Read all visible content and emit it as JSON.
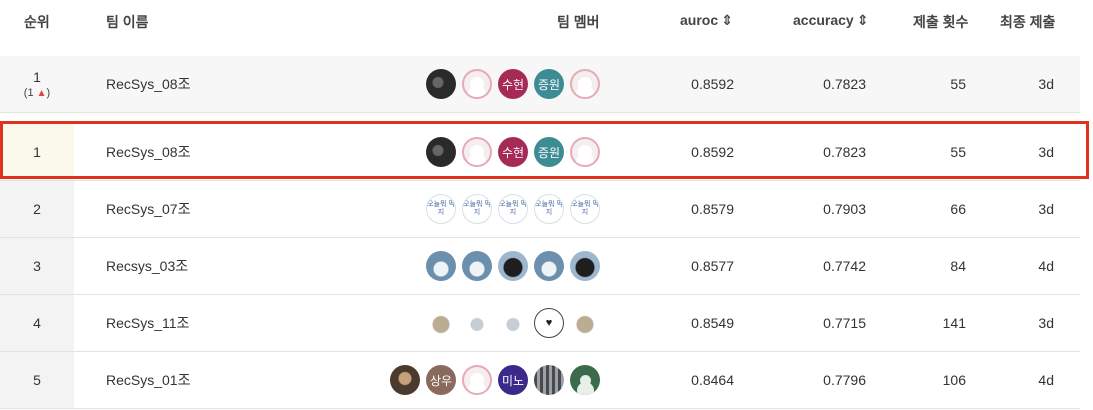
{
  "header": {
    "rank": "순위",
    "team": "팀 이름",
    "members": "팀 멤버",
    "auroc": "auroc",
    "accuracy": "accuracy",
    "submissions": "제출 횟수",
    "last": "최종 제출",
    "sort_icon": "⇕"
  },
  "rows": [
    {
      "rank": "1",
      "delta": "(1",
      "team": "RecSys_08조",
      "auroc": "0.8592",
      "accuracy": "0.7823",
      "count": "55",
      "last": "3d",
      "bar": "#3b3b3b",
      "avatars": [
        {
          "t": "",
          "c": "photo-dark"
        },
        {
          "t": "",
          "c": "person"
        },
        {
          "t": "수현",
          "c": "txt-r"
        },
        {
          "t": "증원",
          "c": "txt-t"
        },
        {
          "t": "",
          "c": "person"
        }
      ]
    },
    {
      "rank": "1",
      "team": "RecSys_08조",
      "auroc": "0.8592",
      "accuracy": "0.7823",
      "count": "55",
      "last": "3d",
      "bar": "#f4c20d",
      "avatars": [
        {
          "t": "",
          "c": "photo-dark"
        },
        {
          "t": "",
          "c": "person"
        },
        {
          "t": "수현",
          "c": "txt-r"
        },
        {
          "t": "증원",
          "c": "txt-t"
        },
        {
          "t": "",
          "c": "person"
        }
      ]
    },
    {
      "rank": "2",
      "team": "RecSys_07조",
      "auroc": "0.8579",
      "accuracy": "0.7903",
      "count": "66",
      "last": "3d",
      "bar": "#cccccc",
      "avatars": [
        {
          "t": "오늘뭐 먹지",
          "c": "doodle"
        },
        {
          "t": "오늘뭐 먹지",
          "c": "doodle"
        },
        {
          "t": "오늘뭐 먹지",
          "c": "doodle"
        },
        {
          "t": "오늘뭐 먹지",
          "c": "doodle"
        },
        {
          "t": "오늘뭐 먹지",
          "c": "doodle"
        }
      ]
    },
    {
      "rank": "3",
      "team": "Recsys_03조",
      "auroc": "0.8577",
      "accuracy": "0.7742",
      "count": "84",
      "last": "4d",
      "bar": "#8b5a3c",
      "avatars": [
        {
          "t": "",
          "c": "sea"
        },
        {
          "t": "",
          "c": "sea"
        },
        {
          "t": "",
          "c": "peng"
        },
        {
          "t": "",
          "c": "sea"
        },
        {
          "t": "",
          "c": "peng"
        }
      ]
    },
    {
      "rank": "4",
      "team": "RecSys_11조",
      "auroc": "0.8549",
      "accuracy": "0.7715",
      "count": "141",
      "last": "3d",
      "bar": "#8b5a3c",
      "avatars": [
        {
          "t": "",
          "c": "plush"
        },
        {
          "t": "",
          "c": "plush2"
        },
        {
          "t": "",
          "c": "plush2"
        },
        {
          "t": "♥",
          "c": "bunny"
        },
        {
          "t": "",
          "c": "plush"
        }
      ]
    },
    {
      "rank": "5",
      "team": "RecSys_01조",
      "auroc": "0.8464",
      "accuracy": "0.7796",
      "count": "106",
      "last": "4d",
      "bar": "#8b5a3c",
      "avatars": [
        {
          "t": "",
          "c": "photo-b"
        },
        {
          "t": "상우",
          "c": "txt-s"
        },
        {
          "t": "",
          "c": "person"
        },
        {
          "t": "미노",
          "c": "txt-m"
        },
        {
          "t": "",
          "c": "crowd"
        },
        {
          "t": "",
          "c": "generic"
        }
      ]
    }
  ],
  "colors": {
    "highlight": "#e0301e",
    "rank_up": "#e0453b"
  }
}
